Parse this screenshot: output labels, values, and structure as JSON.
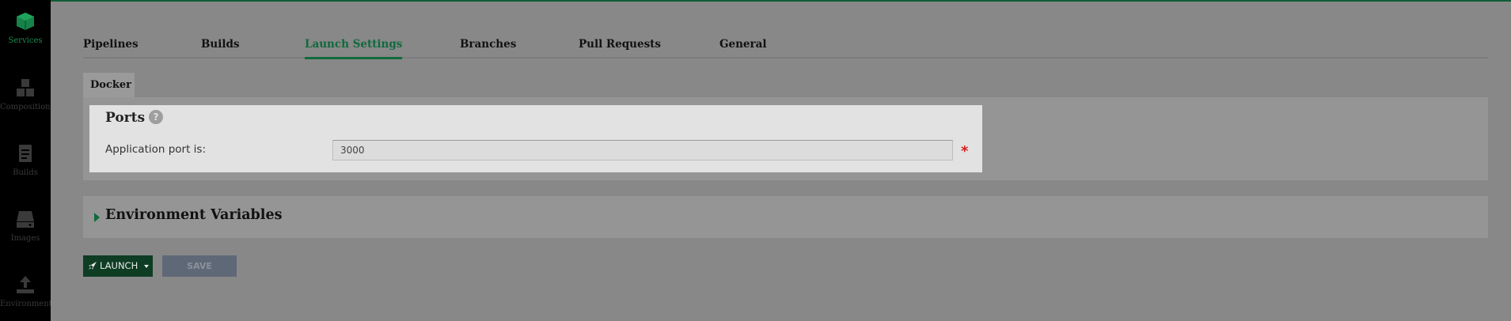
{
  "sidebar": {
    "items": [
      {
        "label": "Services",
        "icon": "cube-icon",
        "active": true
      },
      {
        "label": "Compositions",
        "icon": "boxes-icon",
        "active": false
      },
      {
        "label": "Builds",
        "icon": "document-icon",
        "active": false
      },
      {
        "label": "Images",
        "icon": "drive-icon",
        "active": false
      },
      {
        "label": "Environments",
        "icon": "upload-icon",
        "active": false
      }
    ]
  },
  "tabs": [
    "Pipelines",
    "Builds",
    "Launch Settings",
    "Branches",
    "Pull Requests",
    "General"
  ],
  "active_tab": "Launch Settings",
  "subtab": "Docker",
  "ports": {
    "title": "Ports",
    "label": "Application port is:",
    "value": "3000",
    "required_mark": "*"
  },
  "env": {
    "title": "Environment Variables"
  },
  "actions": {
    "launch": "LAUNCH",
    "save": "SAVE"
  },
  "colors": {
    "accent": "#0f6a3c",
    "sidebar": "#000000",
    "overlay": "#888888",
    "required": "#d61f1f",
    "save_disabled": "#5f6876"
  }
}
